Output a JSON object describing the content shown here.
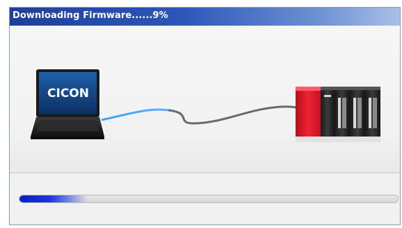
{
  "window": {
    "title": "Downloading Firmware......9%"
  },
  "illustration": {
    "laptop_screen_text": "CICON",
    "laptop_icon": "laptop-icon",
    "cable_icon": "cable-icon",
    "plc_icon": "plc-rack-icon"
  },
  "progress": {
    "percent": 9
  },
  "colors": {
    "title_bar": "#2d58b8",
    "progress_fill": "#1e35db",
    "plc_red": "#e8192c"
  }
}
